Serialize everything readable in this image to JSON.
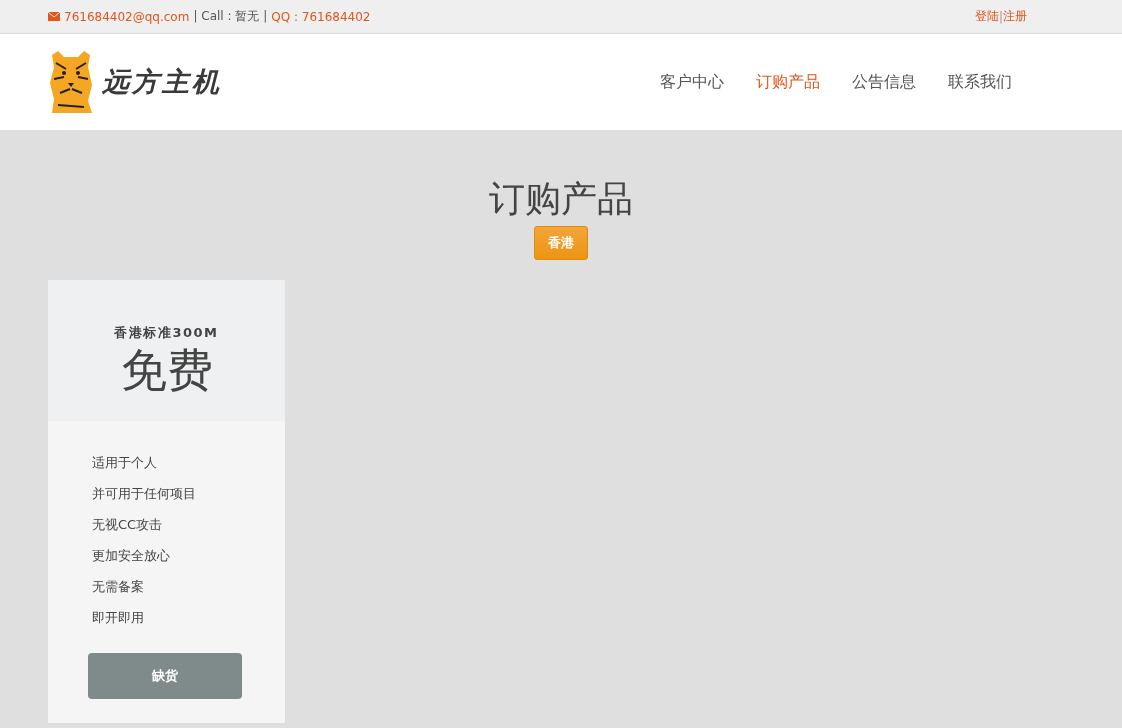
{
  "top_bar": {
    "email": "761684402@qq.com",
    "call": "| Call : 暂无 |",
    "qq": "QQ : 761684402",
    "login": "登陆",
    "separator": "|",
    "register": "注册"
  },
  "header": {
    "logo_text": "远方主机",
    "nav": [
      {
        "label": "客户中心",
        "selected": false
      },
      {
        "label": "订购产品",
        "selected": true
      },
      {
        "label": "公告信息",
        "selected": false
      },
      {
        "label": "联系我们",
        "selected": false
      }
    ]
  },
  "page_title": "订购产品",
  "regions": [
    {
      "label": "香港",
      "selected": true
    }
  ],
  "products": [
    {
      "name": "香港标准300M",
      "price": "免费",
      "features": [
        "适用于个人",
        "并可用于任何项目",
        "无视CC攻击",
        "更加安全放心",
        "无需备案",
        "即开即用"
      ],
      "button": {
        "label": "缺货",
        "disabled": true
      }
    }
  ]
}
